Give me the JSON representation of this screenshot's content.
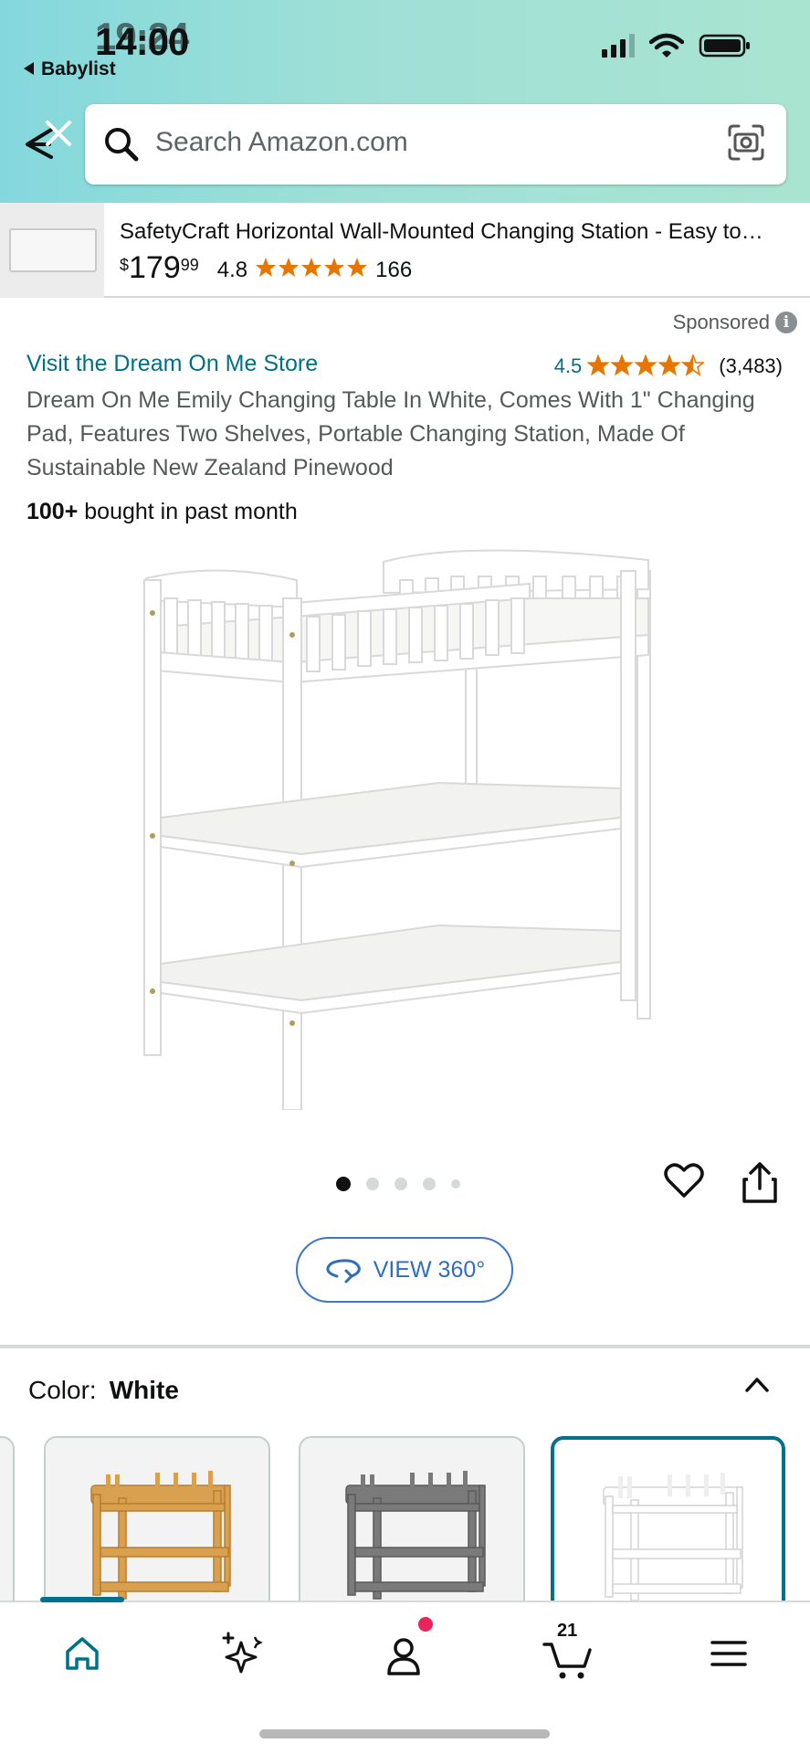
{
  "status_bar": {
    "time": "14:00",
    "time_ghost": "19:24",
    "back_app": "Babylist"
  },
  "search": {
    "placeholder": "Search Amazon.com"
  },
  "sponsored_strip": {
    "title": "SafetyCraft Horizontal Wall-Mounted Changing Station - Easy to…",
    "currency": "$",
    "price_dollars": "179",
    "price_cents": "99",
    "rating": "4.8",
    "reviews": "166"
  },
  "product": {
    "sponsored_label": "Sponsored",
    "store_link": "Visit the Dream On Me Store",
    "rating": "4.5",
    "rating_stars": 4.5,
    "review_count": "(3,483)",
    "title": "Dream On Me Emily Changing Table In White, Comes With 1\" Changing Pad, Features Two Shelves, Portable Changing Station, Made Of Sustainable New Zealand Pinewood",
    "bought_bold": "100+",
    "bought_rest": " bought in past month",
    "image_count": 5,
    "image_index": 1,
    "view360_label": "VIEW 360°"
  },
  "color_selector": {
    "label": "Color:",
    "value": "White",
    "options": [
      "Natural",
      "Storm Grey",
      "White"
    ],
    "selected": "White"
  },
  "bottom_nav": {
    "items": [
      "home",
      "rufus",
      "account",
      "cart",
      "menu"
    ],
    "active": "home",
    "cart_count": "21"
  },
  "colors": {
    "accent": "#007185",
    "star": "#e77600",
    "link_blue": "#2f6eba",
    "badge": "#e8255b"
  }
}
